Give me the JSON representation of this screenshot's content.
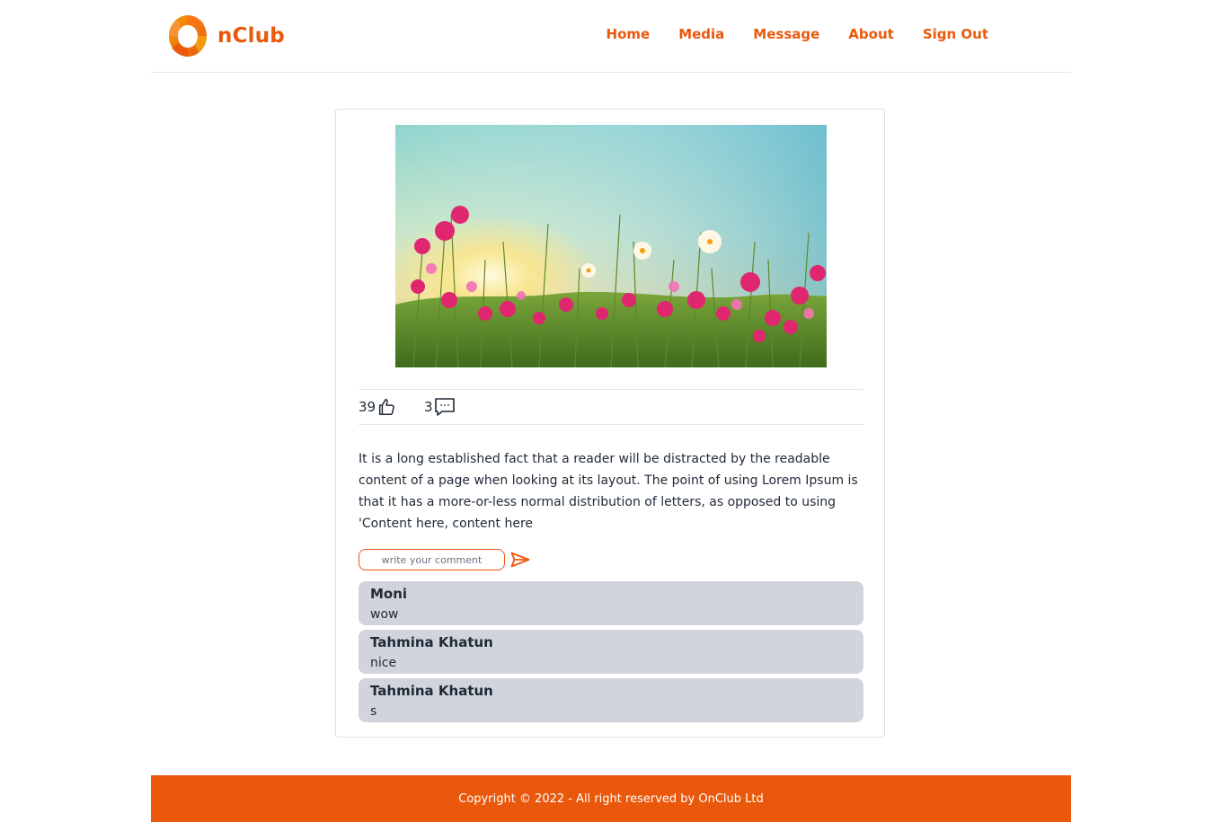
{
  "brand": {
    "name": "nClub",
    "accent_color": "#ea580c"
  },
  "nav": {
    "items": [
      {
        "label": "Home"
      },
      {
        "label": "Media"
      },
      {
        "label": "Message"
      },
      {
        "label": "About"
      },
      {
        "label": "Sign Out"
      }
    ]
  },
  "post": {
    "image_subject": "pink cosmos flowers field at sunrise",
    "likes": "39",
    "comments_count": "3",
    "like_icon": "thumbs-up-icon",
    "comment_icon": "chat-bubble-icon",
    "text": "It is a long established fact that a reader will be distracted by the readable content of a page when looking at its layout. The point of using Lorem Ipsum is that it has a more-or-less normal distribution of letters, as opposed to using 'Content here, content here",
    "comment_placeholder": "write your comment",
    "comment_value": "",
    "send_icon": "send-icon"
  },
  "comments": [
    {
      "author": "Moni",
      "text": "wow"
    },
    {
      "author": "Tahmina Khatun",
      "text": "nice"
    },
    {
      "author": "Tahmina Khatun",
      "text": "s"
    }
  ],
  "footer": {
    "copyright": "Copyright © 2022 - All right reserved by OnClub Ltd"
  }
}
